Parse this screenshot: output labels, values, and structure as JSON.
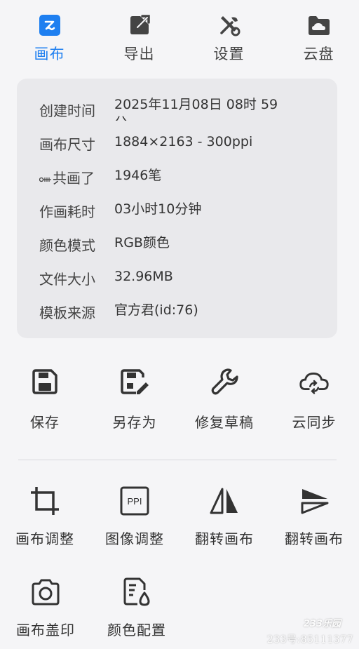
{
  "colors": {
    "accent": "#1e7ff0",
    "icon": "#333333",
    "card_bg": "#e9e9ec"
  },
  "tabs": [
    {
      "label": "画布",
      "icon": "canvas-icon",
      "active": true
    },
    {
      "label": "导出",
      "icon": "export-icon",
      "active": false
    },
    {
      "label": "设置",
      "icon": "settings-icon",
      "active": false
    },
    {
      "label": "云盘",
      "icon": "cloud-drive-icon",
      "active": false
    }
  ],
  "info": {
    "rows": [
      {
        "key": "创建时间",
        "value": "2025年11月08日 08时 59分"
      },
      {
        "key": "画布尺寸",
        "value": "1884×2163 - 300ppi"
      },
      {
        "key": "共画了",
        "value": "1946笔"
      },
      {
        "key": "作画耗时",
        "value": "03小时10分钟"
      },
      {
        "key": "颜色模式",
        "value": "RGB颜色"
      },
      {
        "key": "文件大小",
        "value": "32.96MB"
      },
      {
        "key": "模板来源",
        "value": "官方君(id:76)"
      }
    ]
  },
  "actions_primary": [
    {
      "label": "保存",
      "icon": "save-icon"
    },
    {
      "label": "另存为",
      "icon": "save-as-icon"
    },
    {
      "label": "修复草稿",
      "icon": "wrench-icon"
    },
    {
      "label": "云同步",
      "icon": "cloud-sync-icon"
    }
  ],
  "actions_secondary": [
    {
      "label": "画布调整",
      "icon": "crop-icon"
    },
    {
      "label": "图像调整",
      "icon": "ppi-icon",
      "icon_text": "PPI"
    },
    {
      "label": "翻转画布",
      "icon": "flip-horizontal-icon"
    },
    {
      "label": "翻转画布",
      "icon": "flip-vertical-icon"
    },
    {
      "label": "画布盖印",
      "icon": "camera-icon"
    },
    {
      "label": "颜色配置",
      "icon": "color-profile-icon"
    }
  ],
  "watermark": {
    "logo": "233乐园",
    "id": "233号:85111377"
  }
}
